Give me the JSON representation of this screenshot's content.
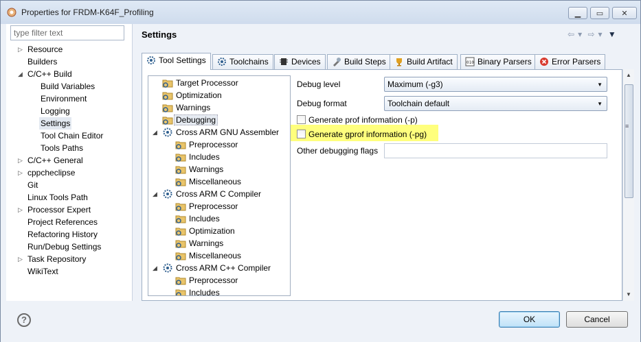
{
  "window": {
    "title": "Properties for FRDM-K64F_Profiling",
    "controls": [
      "minimize",
      "maximize",
      "close"
    ]
  },
  "sidebar": {
    "filter_placeholder": "type filter text",
    "items": [
      {
        "label": "Resource",
        "expandable": true
      },
      {
        "label": "Builders"
      },
      {
        "label": "C/C++ Build",
        "expanded": true
      },
      {
        "label": "Build Variables"
      },
      {
        "label": "Environment"
      },
      {
        "label": "Logging"
      },
      {
        "label": "Settings",
        "selected": true
      },
      {
        "label": "Tool Chain Editor"
      },
      {
        "label": "Tools Paths"
      },
      {
        "label": "C/C++ General",
        "expandable": true
      },
      {
        "label": "cppcheclipse",
        "expandable": true
      },
      {
        "label": "Git"
      },
      {
        "label": "Linux Tools Path"
      },
      {
        "label": "Processor Expert",
        "expandable": true
      },
      {
        "label": "Project References"
      },
      {
        "label": "Refactoring History"
      },
      {
        "label": "Run/Debug Settings"
      },
      {
        "label": "Task Repository",
        "expandable": true
      },
      {
        "label": "WikiText"
      }
    ]
  },
  "main": {
    "title": "Settings",
    "tabs": [
      {
        "label": "Tool Settings",
        "active": true
      },
      {
        "label": "Toolchains"
      },
      {
        "label": "Devices"
      },
      {
        "label": "Build Steps"
      },
      {
        "label": "Build Artifact"
      },
      {
        "label": "Binary Parsers"
      },
      {
        "label": "Error Parsers"
      }
    ],
    "tree": [
      {
        "label": "Target Processor",
        "level": 1
      },
      {
        "label": "Optimization",
        "level": 1
      },
      {
        "label": "Warnings",
        "level": 1
      },
      {
        "label": "Debugging",
        "level": 1,
        "selected": true
      },
      {
        "label": "Cross ARM GNU Assembler",
        "level": 0
      },
      {
        "label": "Preprocessor",
        "level": 2
      },
      {
        "label": "Includes",
        "level": 2
      },
      {
        "label": "Warnings",
        "level": 2
      },
      {
        "label": "Miscellaneous",
        "level": 2
      },
      {
        "label": "Cross ARM C Compiler",
        "level": 0
      },
      {
        "label": "Preprocessor",
        "level": 2
      },
      {
        "label": "Includes",
        "level": 2
      },
      {
        "label": "Optimization",
        "level": 2
      },
      {
        "label": "Warnings",
        "level": 2
      },
      {
        "label": "Miscellaneous",
        "level": 2
      },
      {
        "label": "Cross ARM C++ Compiler",
        "level": 0
      },
      {
        "label": "Preprocessor",
        "level": 2
      },
      {
        "label": "Includes",
        "level": 2
      }
    ],
    "debug_level": {
      "label": "Debug level",
      "value": "Maximum (-g3)"
    },
    "debug_format": {
      "label": "Debug format",
      "value": "Toolchain default"
    },
    "gen_prof": {
      "label": "Generate prof information (-p)",
      "checked": false
    },
    "gen_gprof": {
      "label": "Generate gprof information (-pg)",
      "checked": false
    },
    "other_flags": {
      "label": "Other debugging flags",
      "value": ""
    }
  },
  "footer": {
    "ok_label": "OK",
    "cancel_label": "Cancel"
  },
  "colors": {
    "highlight": "#ffff66",
    "ok_accent": "#3c7fb1"
  }
}
